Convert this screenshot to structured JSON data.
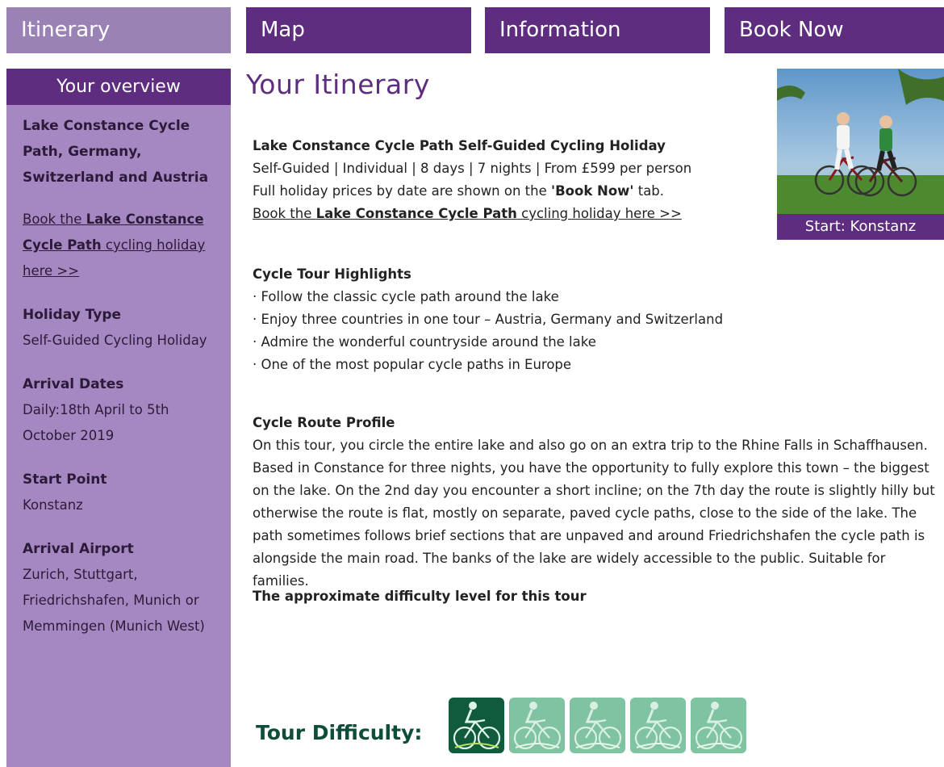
{
  "nav": {
    "itinerary": "Itinerary",
    "map": "Map",
    "information": "Information",
    "book_now": "Book Now"
  },
  "sidebar": {
    "header": "Your overview",
    "title": "Lake Constance Cycle Path, Germany, Switzerland and Austria",
    "book_link_pre": "Book the ",
    "book_link_bold": "Lake Constance Cycle Path",
    "book_link_post": " cycling holiday here >>",
    "holiday_type_label": "Holiday Type",
    "holiday_type_value": "Self-Guided Cycling Holiday",
    "arrival_dates_label": "Arrival Dates",
    "arrival_dates_value": "Daily:18th April to 5th October 2019",
    "start_point_label": "Start Point",
    "start_point_value": "Konstanz",
    "arrival_airport_label": "Arrival Airport",
    "arrival_airport_value": "Zurich, Stuttgart, Friedrichshafen, Munich or Memmingen (Munich West)"
  },
  "main": {
    "title": "Your Itinerary",
    "holiday_name": "Lake Constance Cycle Path Self-Guided Cycling Holiday",
    "summary": "Self-Guided | Individual | 8 days | 7 nights | From £599 per person",
    "prices_pre": "Full holiday prices by date are shown on the ",
    "prices_bold": "'Book Now'",
    "prices_post": " tab.",
    "book_pre": "Book the ",
    "book_bold": "Lake Constance Cycle Path",
    "book_post": " cycling holiday here >>",
    "photo_caption": "Start: Konstanz",
    "highlights_heading": "Cycle Tour Highlights",
    "highlights": [
      "· Follow the classic cycle path around the lake",
      "· Enjoy three countries in one tour – Austria, Germany and Switzerland",
      "· Admire the wonderful countryside around the lake",
      "· One of the most popular cycle paths in Europe"
    ],
    "profile_heading": "Cycle Route Profile",
    "profile_text": "On this tour, you circle the entire lake and also go on an extra trip to the Rhine Falls in Schaffhausen. Based in Constance for three nights, you have the opportunity to fully explore this town – the biggest on the lake. On the 2nd day you encounter a short incline; on the 7th day the route is slightly hilly but otherwise the route is flat, mostly on separate, paved cycle paths, close to the side of the lake. The path sometimes follows brief sections that are unpaved and around Friedrichshafen the cycle path is alongside the main road. The banks of the lake are widely accessible to the public. Suitable for families.",
    "difficulty_note": "The approximate difficulty level for this tour",
    "tour_difficulty_label": "Tour Difficulty:",
    "difficulty_level": 1,
    "difficulty_max": 5
  },
  "colors": {
    "purple_dark": "#5e2d80",
    "purple_light": "#a588c2",
    "green_dark": "#0f5b3c",
    "green_light": "#7fc3a2"
  }
}
